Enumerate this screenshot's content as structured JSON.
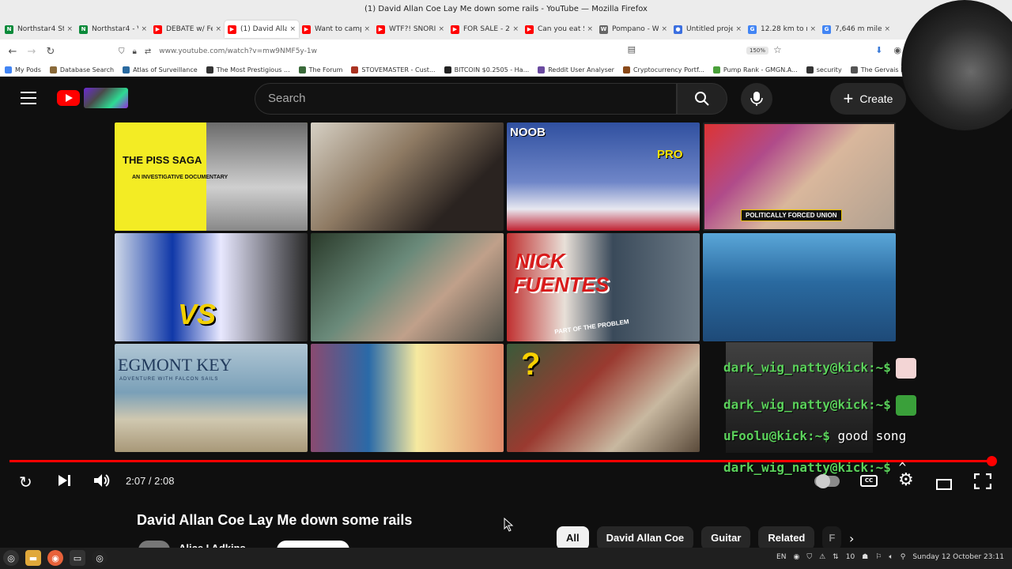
{
  "window": {
    "title": "(1) David Allan Coe Lay Me down some rails - YouTube — Mozilla Firefox"
  },
  "tabs": [
    {
      "label": "Northstar4 St",
      "color": "#0a8a3a",
      "glyph": "N",
      "active": false
    },
    {
      "label": "Northstar4 - V",
      "color": "#0a8a3a",
      "glyph": "N",
      "active": false
    },
    {
      "label": "DEBATE w/ Fe",
      "color": "#ff0000",
      "glyph": "▶",
      "active": false
    },
    {
      "label": "(1) David Allan",
      "color": "#ff0000",
      "glyph": "▶",
      "active": true
    },
    {
      "label": "Want to camp",
      "color": "#ff0000",
      "glyph": "▶",
      "active": false
    },
    {
      "label": "WTF?! SNORII",
      "color": "#ff0000",
      "glyph": "▶",
      "active": false
    },
    {
      "label": "FOR SALE - 20",
      "color": "#ff0000",
      "glyph": "▶",
      "active": false
    },
    {
      "label": "Can you eat Sa",
      "color": "#ff0000",
      "glyph": "▶",
      "active": false
    },
    {
      "label": "Pompano - Wi",
      "color": "#666666",
      "glyph": "W",
      "active": false
    },
    {
      "label": "Untitled proje",
      "color": "#3b6fe0",
      "glyph": "●",
      "active": false
    },
    {
      "label": "12.28 km to m",
      "color": "#4285f4",
      "glyph": "G",
      "active": false
    },
    {
      "label": "7,646 m miles",
      "color": "#4285f4",
      "glyph": "G",
      "active": false
    }
  ],
  "navbar": {
    "url": "www.youtube.com/watch?v=mw9NMF5y-1w",
    "zoom": "150%"
  },
  "bookmarks": [
    {
      "label": "My Pods",
      "color": "#4285f4"
    },
    {
      "label": "Database Search",
      "color": "#8a6a3a"
    },
    {
      "label": "Atlas of Surveillance",
      "color": "#2a6aa0"
    },
    {
      "label": "The Most Prestigious ...",
      "color": "#333333"
    },
    {
      "label": "The Forum",
      "color": "#3a6a3a"
    },
    {
      "label": "STOVEMASTER - Cust...",
      "color": "#aa3322"
    },
    {
      "label": "BITCOIN $0.2505 - Ha...",
      "color": "#222222"
    },
    {
      "label": "Reddit User Analyser",
      "color": "#6a4aa0"
    },
    {
      "label": "Cryptocurrency Portf...",
      "color": "#8a4a1a"
    },
    {
      "label": "Pump Rank - GMGN.A...",
      "color": "#4aa03a"
    },
    {
      "label": "security",
      "color": "#333333"
    },
    {
      "label": "The Gervais P",
      "color": "#555555"
    }
  ],
  "youtube": {
    "search_placeholder": "Search",
    "create_label": "Create"
  },
  "thumbnails": {
    "t1": {
      "line1": "THE PISS SAGA",
      "line2": "AN INVESTIGATIVE DOCUMENTARY"
    },
    "t3": {
      "left": "NOOB",
      "right": "PRO"
    },
    "t4": {
      "banner": "POLITICALLY FORCED UNION"
    },
    "t5": {
      "text": "VS"
    },
    "t7": {
      "line1": "NICK",
      "line2": "FUENTES",
      "line3": "PART OF THE PROBLEM"
    },
    "t9": {
      "title": "EGMONT KEY",
      "subtitle": "ADVENTURE WITH FALCON SAILS"
    },
    "t11": {
      "mark": "?"
    }
  },
  "chat": [
    {
      "user": "dark_wig_natty@kick:~$",
      "message": "",
      "emote": "#f3d5d5"
    },
    {
      "user": "dark_wig_natty@kick:~$",
      "message": "",
      "emote": "#3aa03a"
    },
    {
      "user": "uFoolu@kick:~$",
      "message": "good song",
      "emote": ""
    },
    {
      "user": "dark_wig_natty@kick:~$",
      "message": "^",
      "emote": ""
    }
  ],
  "player": {
    "time": "2:07 / 2:08",
    "progress_fraction": 0.99,
    "cc_label": "CC"
  },
  "video": {
    "title": "David Allan Coe Lay Me down some rails",
    "channel": "Alice I Adkins"
  },
  "chips": [
    "All",
    "David Allan Coe",
    "Guitar",
    "Related",
    "F"
  ],
  "taskbar": {
    "lang": "EN",
    "badge": "10",
    "datetime": "Sunday 12 October 23:11"
  }
}
